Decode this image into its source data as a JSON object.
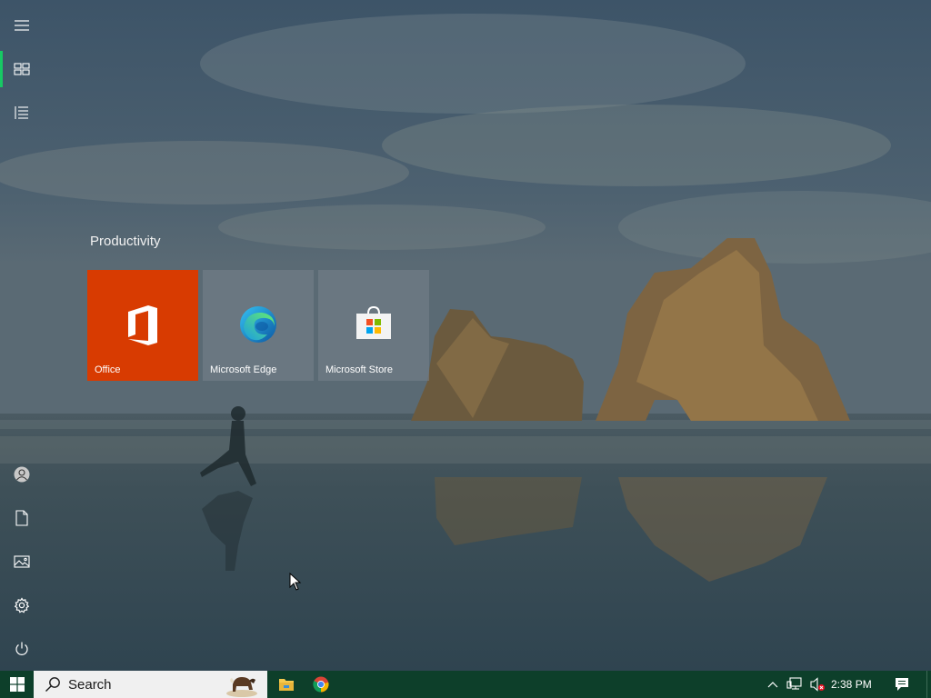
{
  "rail": {
    "items": [
      {
        "name": "expand-menu",
        "icon": "hamburger-icon"
      },
      {
        "name": "pinned-tiles",
        "icon": "tiles-icon",
        "active": true
      },
      {
        "name": "all-apps",
        "icon": "list-icon"
      },
      {
        "name": "user-account",
        "icon": "user-icon"
      },
      {
        "name": "documents",
        "icon": "document-icon"
      },
      {
        "name": "pictures",
        "icon": "picture-icon"
      },
      {
        "name": "settings",
        "icon": "gear-icon"
      },
      {
        "name": "power",
        "icon": "power-icon"
      }
    ],
    "accent_color": "#17c964"
  },
  "tiles_group": {
    "title": "Productivity",
    "tiles": [
      {
        "label": "Office",
        "icon": "office-icon",
        "color": "#d83b01"
      },
      {
        "label": "Microsoft Edge",
        "icon": "edge-icon"
      },
      {
        "label": "Microsoft Store",
        "icon": "store-icon"
      }
    ]
  },
  "taskbar": {
    "search_placeholder": "Search",
    "clock": "2:38 PM",
    "background_color": "#0d3f2a",
    "pinned": [
      {
        "name": "file-explorer",
        "icon": "folder-icon"
      },
      {
        "name": "chrome",
        "icon": "chrome-icon"
      }
    ],
    "tray": [
      "chevron-up-icon",
      "network-icon",
      "volume-muted-icon",
      "action-center-icon"
    ]
  }
}
